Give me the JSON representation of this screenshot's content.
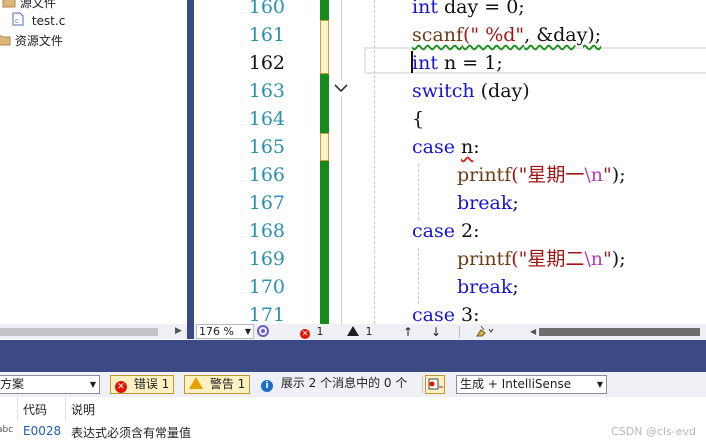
{
  "explorer": {
    "items": [
      {
        "label": "源文件",
        "icon": "folder-icon"
      },
      {
        "label": "test.c",
        "icon": "c-file-icon"
      },
      {
        "label": "资源文件",
        "icon": "folder-icon"
      }
    ]
  },
  "editor": {
    "line_numbers": [
      "160",
      "161",
      "162",
      "163",
      "164",
      "165",
      "166",
      "167",
      "168",
      "169",
      "170",
      "171"
    ],
    "current_line": "162",
    "code": {
      "l160": {
        "kw": "int",
        "rest": " day = 0;"
      },
      "l161": {
        "fn": "scanf",
        "str": "(\" %d\"",
        "rest": ", &day);"
      },
      "l162": {
        "kw": "int",
        "rest": " n = 1;"
      },
      "l163": {
        "kw": "switch",
        "rest": " (day)"
      },
      "l164": {
        "text": "{"
      },
      "l165": {
        "kw": "case",
        "sp": " ",
        "ident": "n",
        "rest": ":"
      },
      "l166": {
        "fn": "printf",
        "str": "(\"星期一",
        "esc": "\\n",
        "str2": "\"",
        "rest": ");"
      },
      "l167": {
        "kw": "break",
        "rest": ";"
      },
      "l168": {
        "kw": "case",
        "rest": " 2:"
      },
      "l169": {
        "fn": "printf",
        "str": "(\"星期二",
        "esc": "\\n",
        "str2": "\"",
        "rest": ");"
      },
      "l170": {
        "kw": "break",
        "rest": ";"
      },
      "l171": {
        "kw": "case",
        "rest": " 3:"
      }
    }
  },
  "editor_status": {
    "zoom": "176 %",
    "errors": "1",
    "warnings": "1"
  },
  "error_list": {
    "scope_combo": "方案",
    "errors_button": "错误 1",
    "warnings_button": "警告 1",
    "messages_button": "展示 2 个消息中的 0 个",
    "build_filter": "生成 + IntelliSense",
    "headers": {
      "code": "代码",
      "description": "说明"
    },
    "rows": [
      {
        "icon_text": "abc",
        "code": "E0028",
        "description": "表达式必须含有常量值"
      }
    ]
  },
  "watermark": "CSDN @cls-evd",
  "colors": {
    "accent_navy": "#3c4a84",
    "change_green": "#168a1f",
    "keyword": "#1515d2",
    "line_number": "#2b91af"
  }
}
